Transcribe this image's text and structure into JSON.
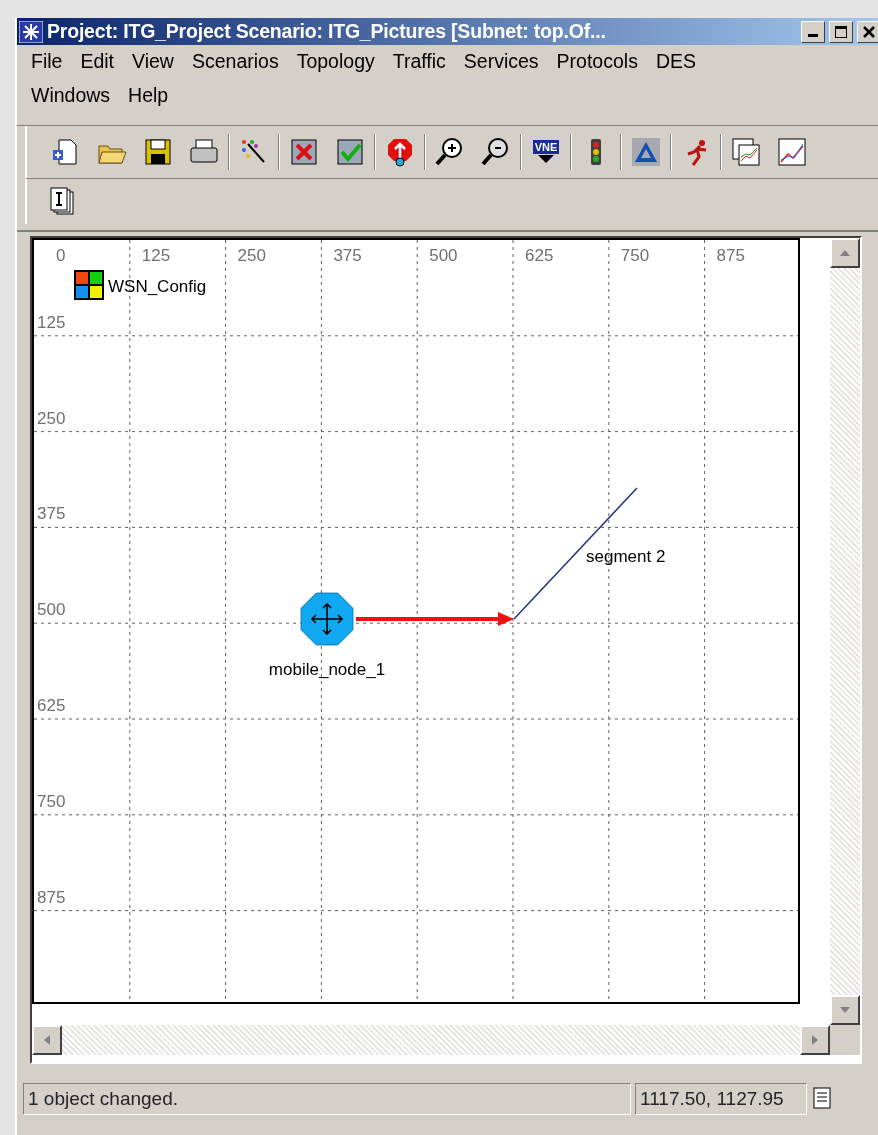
{
  "window": {
    "title": "Project: ITG_Project Scenario: ITG_Pictures  [Subnet: top.Of..."
  },
  "menu": [
    {
      "label": "File"
    },
    {
      "label": "Edit"
    },
    {
      "label": "View"
    },
    {
      "label": "Scenarios"
    },
    {
      "label": "Topology"
    },
    {
      "label": "Traffic"
    },
    {
      "label": "Services"
    },
    {
      "label": "Protocols"
    },
    {
      "label": "DES"
    },
    {
      "label": "Windows"
    },
    {
      "label": "Help"
    }
  ],
  "toolbar": {
    "vne_label": "VNE"
  },
  "canvas": {
    "x_ticks": [
      "0",
      "125",
      "250",
      "375",
      "500",
      "625",
      "750",
      "875"
    ],
    "y_ticks": [
      "125",
      "250",
      "375",
      "500",
      "625",
      "750",
      "875"
    ],
    "nodes": [
      {
        "kind": "config",
        "label": "WSN_Config"
      },
      {
        "kind": "mobile",
        "label": "mobile_node_1"
      }
    ],
    "segments": [
      {
        "label": "segment 2"
      }
    ]
  },
  "status_bar": {
    "message": "1 object changed.",
    "coordinates": "1117.50, 1127.95"
  }
}
